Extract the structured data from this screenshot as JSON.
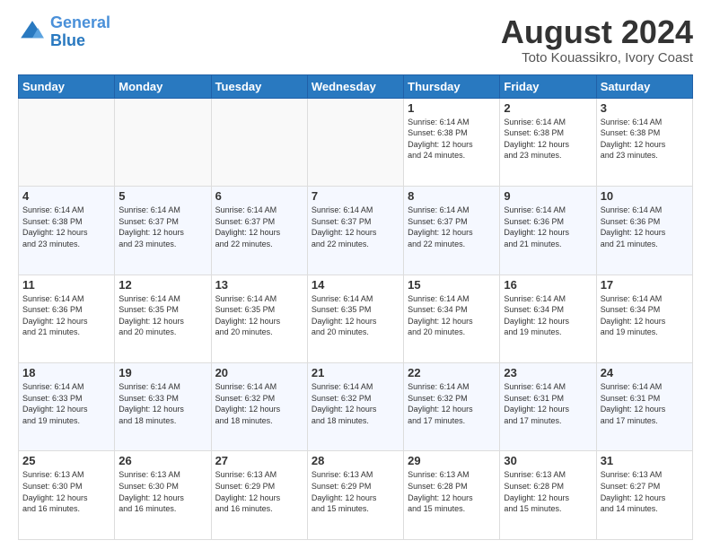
{
  "logo": {
    "line1": "General",
    "line2": "Blue"
  },
  "title": "August 2024",
  "subtitle": "Toto Kouassikro, Ivory Coast",
  "days_of_week": [
    "Sunday",
    "Monday",
    "Tuesday",
    "Wednesday",
    "Thursday",
    "Friday",
    "Saturday"
  ],
  "weeks": [
    [
      {
        "day": "",
        "info": ""
      },
      {
        "day": "",
        "info": ""
      },
      {
        "day": "",
        "info": ""
      },
      {
        "day": "",
        "info": ""
      },
      {
        "day": "1",
        "info": "Sunrise: 6:14 AM\nSunset: 6:38 PM\nDaylight: 12 hours\nand 24 minutes."
      },
      {
        "day": "2",
        "info": "Sunrise: 6:14 AM\nSunset: 6:38 PM\nDaylight: 12 hours\nand 23 minutes."
      },
      {
        "day": "3",
        "info": "Sunrise: 6:14 AM\nSunset: 6:38 PM\nDaylight: 12 hours\nand 23 minutes."
      }
    ],
    [
      {
        "day": "4",
        "info": "Sunrise: 6:14 AM\nSunset: 6:38 PM\nDaylight: 12 hours\nand 23 minutes."
      },
      {
        "day": "5",
        "info": "Sunrise: 6:14 AM\nSunset: 6:37 PM\nDaylight: 12 hours\nand 23 minutes."
      },
      {
        "day": "6",
        "info": "Sunrise: 6:14 AM\nSunset: 6:37 PM\nDaylight: 12 hours\nand 22 minutes."
      },
      {
        "day": "7",
        "info": "Sunrise: 6:14 AM\nSunset: 6:37 PM\nDaylight: 12 hours\nand 22 minutes."
      },
      {
        "day": "8",
        "info": "Sunrise: 6:14 AM\nSunset: 6:37 PM\nDaylight: 12 hours\nand 22 minutes."
      },
      {
        "day": "9",
        "info": "Sunrise: 6:14 AM\nSunset: 6:36 PM\nDaylight: 12 hours\nand 21 minutes."
      },
      {
        "day": "10",
        "info": "Sunrise: 6:14 AM\nSunset: 6:36 PM\nDaylight: 12 hours\nand 21 minutes."
      }
    ],
    [
      {
        "day": "11",
        "info": "Sunrise: 6:14 AM\nSunset: 6:36 PM\nDaylight: 12 hours\nand 21 minutes."
      },
      {
        "day": "12",
        "info": "Sunrise: 6:14 AM\nSunset: 6:35 PM\nDaylight: 12 hours\nand 20 minutes."
      },
      {
        "day": "13",
        "info": "Sunrise: 6:14 AM\nSunset: 6:35 PM\nDaylight: 12 hours\nand 20 minutes."
      },
      {
        "day": "14",
        "info": "Sunrise: 6:14 AM\nSunset: 6:35 PM\nDaylight: 12 hours\nand 20 minutes."
      },
      {
        "day": "15",
        "info": "Sunrise: 6:14 AM\nSunset: 6:34 PM\nDaylight: 12 hours\nand 20 minutes."
      },
      {
        "day": "16",
        "info": "Sunrise: 6:14 AM\nSunset: 6:34 PM\nDaylight: 12 hours\nand 19 minutes."
      },
      {
        "day": "17",
        "info": "Sunrise: 6:14 AM\nSunset: 6:34 PM\nDaylight: 12 hours\nand 19 minutes."
      }
    ],
    [
      {
        "day": "18",
        "info": "Sunrise: 6:14 AM\nSunset: 6:33 PM\nDaylight: 12 hours\nand 19 minutes."
      },
      {
        "day": "19",
        "info": "Sunrise: 6:14 AM\nSunset: 6:33 PM\nDaylight: 12 hours\nand 18 minutes."
      },
      {
        "day": "20",
        "info": "Sunrise: 6:14 AM\nSunset: 6:32 PM\nDaylight: 12 hours\nand 18 minutes."
      },
      {
        "day": "21",
        "info": "Sunrise: 6:14 AM\nSunset: 6:32 PM\nDaylight: 12 hours\nand 18 minutes."
      },
      {
        "day": "22",
        "info": "Sunrise: 6:14 AM\nSunset: 6:32 PM\nDaylight: 12 hours\nand 17 minutes."
      },
      {
        "day": "23",
        "info": "Sunrise: 6:14 AM\nSunset: 6:31 PM\nDaylight: 12 hours\nand 17 minutes."
      },
      {
        "day": "24",
        "info": "Sunrise: 6:14 AM\nSunset: 6:31 PM\nDaylight: 12 hours\nand 17 minutes."
      }
    ],
    [
      {
        "day": "25",
        "info": "Sunrise: 6:13 AM\nSunset: 6:30 PM\nDaylight: 12 hours\nand 16 minutes."
      },
      {
        "day": "26",
        "info": "Sunrise: 6:13 AM\nSunset: 6:30 PM\nDaylight: 12 hours\nand 16 minutes."
      },
      {
        "day": "27",
        "info": "Sunrise: 6:13 AM\nSunset: 6:29 PM\nDaylight: 12 hours\nand 16 minutes."
      },
      {
        "day": "28",
        "info": "Sunrise: 6:13 AM\nSunset: 6:29 PM\nDaylight: 12 hours\nand 15 minutes."
      },
      {
        "day": "29",
        "info": "Sunrise: 6:13 AM\nSunset: 6:28 PM\nDaylight: 12 hours\nand 15 minutes."
      },
      {
        "day": "30",
        "info": "Sunrise: 6:13 AM\nSunset: 6:28 PM\nDaylight: 12 hours\nand 15 minutes."
      },
      {
        "day": "31",
        "info": "Sunrise: 6:13 AM\nSunset: 6:27 PM\nDaylight: 12 hours\nand 14 minutes."
      }
    ]
  ]
}
